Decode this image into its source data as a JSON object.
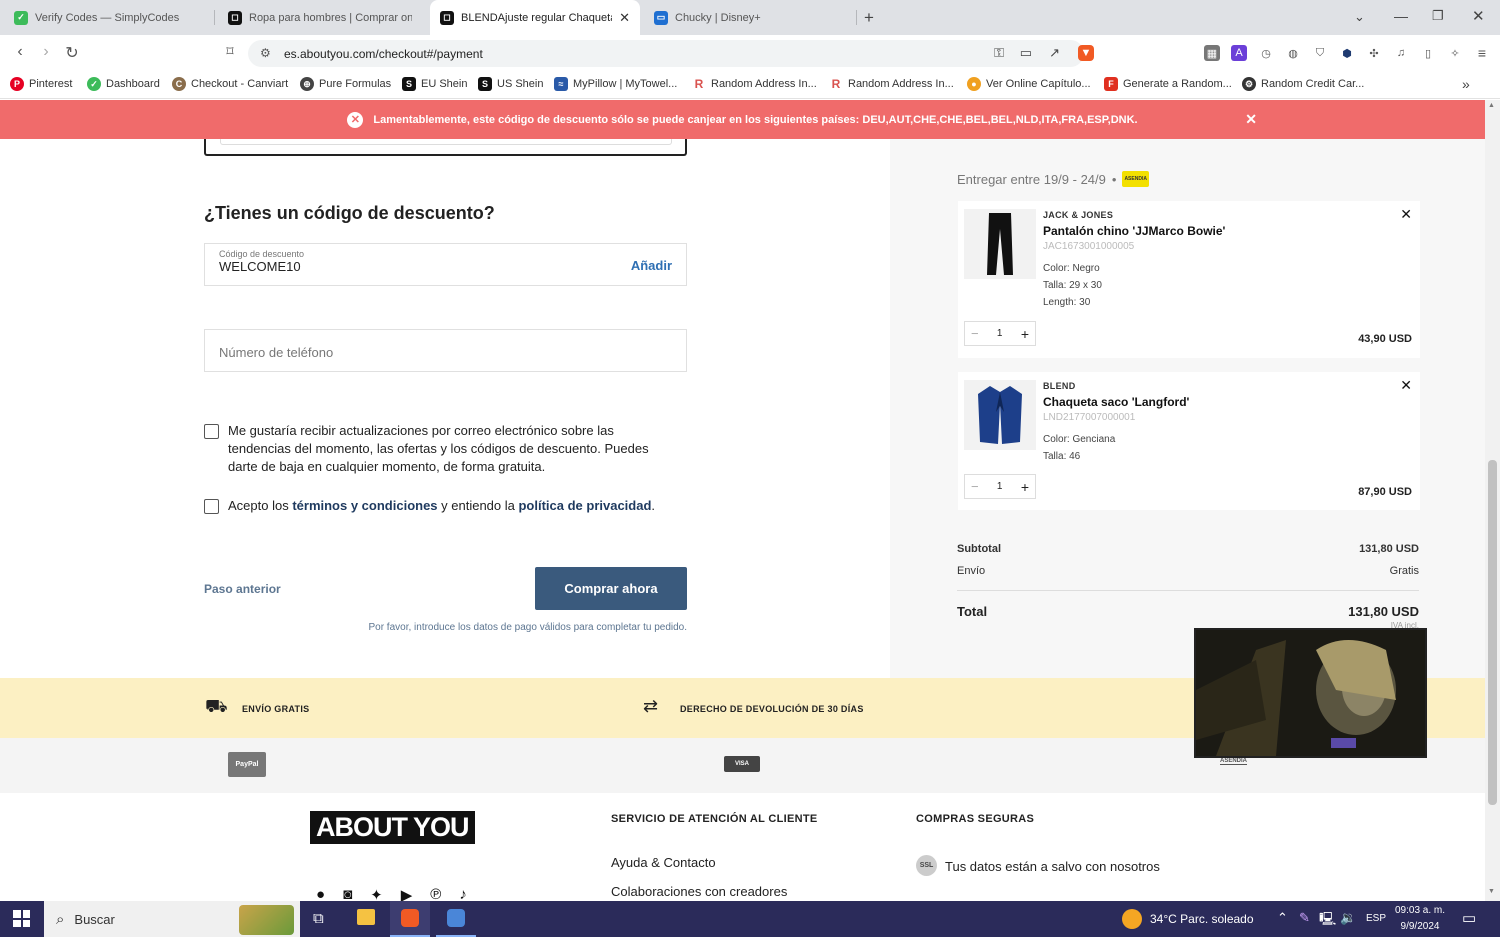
{
  "browser": {
    "tabs": [
      {
        "title": "Verify Codes — SimplyCodes",
        "icon": "simplycodes-icon",
        "color": "#3dbb5a",
        "active": false
      },
      {
        "title": "Ropa para hombres | Comprar online",
        "icon": "aboutyou-icon",
        "color": "#111111",
        "active": false
      },
      {
        "title": "BLENDAjuste regular Chaqueta",
        "icon": "aboutyou-icon",
        "color": "#111111",
        "active": true
      },
      {
        "title": "Chucky | Disney+",
        "icon": "disney-icon",
        "color": "#1f6fd1",
        "active": false
      }
    ],
    "new_tab_label": "+",
    "url": "es.aboutyou.com/checkout#/payment",
    "bookmarks": [
      {
        "label": "Pinterest",
        "color": "#e60023",
        "glyph": "P"
      },
      {
        "label": "Dashboard",
        "color": "#3dbb5a",
        "glyph": "✓"
      },
      {
        "label": "Checkout - Canviart",
        "color": "#8a6d4b",
        "glyph": "C"
      },
      {
        "label": "Pure Formulas",
        "color": "#444444",
        "glyph": "⊕"
      },
      {
        "label": "EU Shein",
        "color": "#111111",
        "glyph": "S"
      },
      {
        "label": "US Shein",
        "color": "#111111",
        "glyph": "S"
      },
      {
        "label": "MyPillow | MyTowel...",
        "color": "#2a5aa8",
        "glyph": "≈"
      },
      {
        "label": "Random Address In...",
        "color": "#d9534f",
        "glyph": "R"
      },
      {
        "label": "Random Address In...",
        "color": "#d9534f",
        "glyph": "R"
      },
      {
        "label": "Ver Online Capítulo...",
        "color": "#f0a020",
        "glyph": "●"
      },
      {
        "label": "Generate a Random...",
        "color": "#e03020",
        "glyph": "F"
      },
      {
        "label": "Random Credit Car...",
        "color": "#333333",
        "glyph": "⚙"
      }
    ],
    "bookmarks_more": "»"
  },
  "alert": {
    "message": "Lamentablemente, este código de descuento sólo se puede canjear en los siguientes países: DEU,AUT,CHE,CHE,BEL,BEL,NLD,ITA,FRA,ESP,DNK.",
    "color": "#f06b6b"
  },
  "form": {
    "discount_heading": "¿Tienes un código de descuento?",
    "discount_label": "Código de descuento",
    "discount_value": "WELCOME10",
    "discount_add": "Añadir",
    "phone_placeholder": "Número de teléfono",
    "newsletter_text": "Me gustaría recibir actualizaciones por correo electrónico sobre las tendencias del momento, las ofertas y los códigos de descuento. Puedes darte de baja en cualquier momento, de forma gratuita.",
    "terms_pre": "Acepto los ",
    "terms_link": "términos y condiciones",
    "terms_mid": " y entiendo la ",
    "privacy_link": "política de privacidad",
    "terms_post": ".",
    "back_label": "Paso anterior",
    "buy_label": "Comprar ahora",
    "buy_color": "#3a5a7d",
    "hint": "Por favor, introduce los datos de pago válidos para completar tu pedido."
  },
  "cart": {
    "delivery": "Entregar entre 19/9 - 24/9",
    "delivery_sep": "•",
    "carrier_badge": "ASENDIA",
    "items": [
      {
        "brand": "JACK & JONES",
        "name": "Pantalón chino 'JJMarco Bowie'",
        "sku": "JAC1673001000005",
        "attrs": [
          "Color: Negro",
          "Talla: 29 x 30",
          "Length: 30"
        ],
        "qty": "1",
        "price": "43,90 USD"
      },
      {
        "brand": "BLEND",
        "name": "Chaqueta saco 'Langford'",
        "sku": "LND2177007000001",
        "attrs": [
          "Color: Genciana",
          "Talla: 46"
        ],
        "qty": "1",
        "price": "87,90 USD"
      }
    ],
    "subtotal_label": "Subtotal",
    "subtotal_value": "131,80 USD",
    "shipping_label": "Envío",
    "shipping_value": "Gratis",
    "total_label": "Total",
    "total_value": "131,80 USD",
    "vat_note": "IVA incl."
  },
  "benefits": {
    "free_shipping": "ENVÍO GRATIS",
    "returns": "DERECHO DE DEVOLUCIÓN DE 30 DÍAS"
  },
  "payments": {
    "paypal": "PayPal",
    "visa": "VISA",
    "asendia": "ASENDIA"
  },
  "footer": {
    "logo": "ABOUT YOU",
    "service_heading": "SERVICIO DE ATENCIÓN AL CLIENTE",
    "service_links": [
      "Ayuda & Contacto",
      "Colaboraciones con creadores"
    ],
    "secure_heading": "COMPRAS SEGURAS",
    "ssl_badge": "SSL",
    "secure_text": "Tus datos están a salvo con nosotros"
  },
  "taskbar": {
    "search": "Buscar",
    "weather": "34°C  Parc. soleado",
    "lang": "ESP",
    "time": "09:03 a. m.",
    "date": "9/9/2024"
  }
}
